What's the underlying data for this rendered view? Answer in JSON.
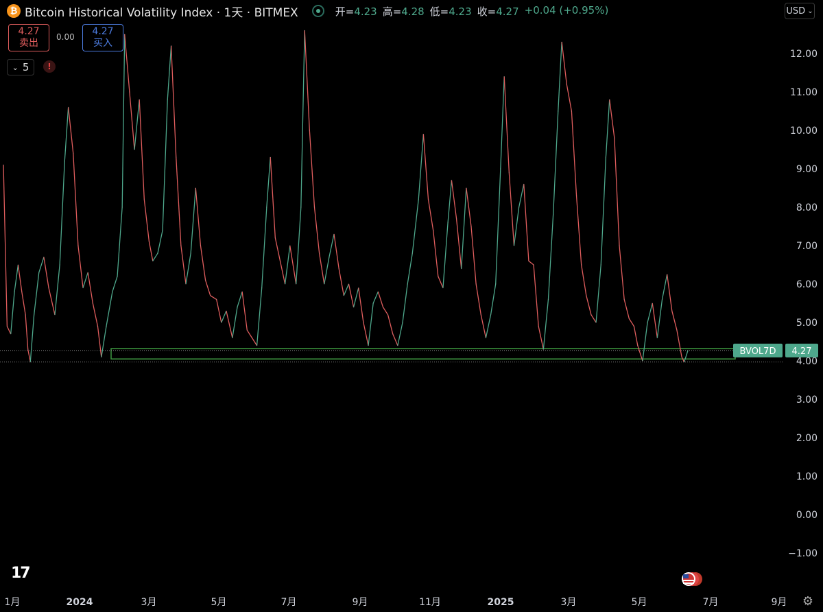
{
  "header": {
    "title": "Bitcoin Historical Volatility Index · 1天 · BITMEX",
    "icon": "bitcoin-icon",
    "ohlc": [
      {
        "key": "开=",
        "value": "4.23"
      },
      {
        "key": "高=",
        "value": "4.28"
      },
      {
        "key": "低=",
        "value": "4.23"
      },
      {
        "key": "收=",
        "value": "4.27"
      }
    ],
    "change": "+0.04 (+0.95%)"
  },
  "currency": {
    "label": "USD"
  },
  "trade": {
    "sell_price": "4.27",
    "sell_label": "卖出",
    "spread": "0.00",
    "buy_price": "4.27",
    "buy_label": "买入"
  },
  "indicators": {
    "count": "5"
  },
  "colors": {
    "up": "#4ea88c",
    "down": "#e05d5d",
    "zone": "#3f9a42",
    "background": "#000000"
  },
  "chart_data": {
    "type": "line",
    "symbol_label": "BVOL7D",
    "last_value": 4.27,
    "support_zone": [
      4.05,
      4.32
    ],
    "ylim": [
      -1.6,
      12.7
    ],
    "y_ticks": [
      12,
      11,
      10,
      9,
      8,
      7,
      6,
      5,
      4,
      3,
      2,
      1,
      0,
      -1
    ],
    "y_tick_labels": [
      "12.00",
      "11.00",
      "10.00",
      "9.00",
      "8.00",
      "7.00",
      "6.00",
      "5.00",
      "4.00",
      "3.00",
      "2.00",
      "1.00",
      "0.00",
      "−1.00"
    ],
    "x_tick_labels": [
      "1月",
      "2024",
      "3月",
      "5月",
      "7月",
      "9月",
      "11月",
      "2025",
      "3月",
      "5月",
      "7月",
      "9月"
    ],
    "x_tick_bold": [
      false,
      true,
      false,
      false,
      false,
      false,
      false,
      true,
      false,
      false,
      false,
      false
    ],
    "series": [
      {
        "points": [
          [
            "2023-12-03",
            9.1
          ],
          [
            "2023-12-06",
            4.9
          ],
          [
            "2023-12-09",
            4.7
          ],
          [
            "2023-12-12",
            5.8
          ],
          [
            "2023-12-15",
            6.5
          ],
          [
            "2023-12-18",
            5.8
          ],
          [
            "2023-12-21",
            5.2
          ],
          [
            "2023-12-23",
            4.3
          ],
          [
            "2023-12-25",
            3.97
          ],
          [
            "2023-12-28",
            5.2
          ],
          [
            "2024-01-01",
            6.3
          ],
          [
            "2024-01-05",
            6.7
          ],
          [
            "2024-01-09",
            5.9
          ],
          [
            "2024-01-14",
            5.2
          ],
          [
            "2024-01-18",
            6.5
          ],
          [
            "2024-01-22",
            9.2
          ],
          [
            "2024-01-25",
            10.6
          ],
          [
            "2024-01-29",
            9.4
          ],
          [
            "2024-02-02",
            7.0
          ],
          [
            "2024-02-06",
            5.9
          ],
          [
            "2024-02-10",
            6.3
          ],
          [
            "2024-02-14",
            5.5
          ],
          [
            "2024-02-18",
            4.9
          ],
          [
            "2024-02-21",
            4.1
          ],
          [
            "2024-02-25",
            4.9
          ],
          [
            "2024-03-01",
            5.8
          ],
          [
            "2024-03-05",
            6.2
          ],
          [
            "2024-03-09",
            8.0
          ],
          [
            "2024-03-11",
            12.5
          ],
          [
            "2024-03-15",
            11.0
          ],
          [
            "2024-03-19",
            9.5
          ],
          [
            "2024-03-23",
            10.8
          ],
          [
            "2024-03-27",
            8.2
          ],
          [
            "2024-03-31",
            7.1
          ],
          [
            "2024-04-03",
            6.6
          ],
          [
            "2024-04-07",
            6.8
          ],
          [
            "2024-04-11",
            7.4
          ],
          [
            "2024-04-15",
            10.8
          ],
          [
            "2024-04-18",
            12.2
          ],
          [
            "2024-04-22",
            9.3
          ],
          [
            "2024-04-26",
            7.0
          ],
          [
            "2024-04-30",
            6.0
          ],
          [
            "2024-05-04",
            6.8
          ],
          [
            "2024-05-08",
            8.5
          ],
          [
            "2024-05-12",
            7.0
          ],
          [
            "2024-05-16",
            6.1
          ],
          [
            "2024-05-20",
            5.7
          ],
          [
            "2024-05-25",
            5.6
          ],
          [
            "2024-05-29",
            5.0
          ],
          [
            "2024-06-02",
            5.3
          ],
          [
            "2024-06-07",
            4.6
          ],
          [
            "2024-06-11",
            5.4
          ],
          [
            "2024-06-15",
            5.8
          ],
          [
            "2024-06-19",
            4.8
          ],
          [
            "2024-06-23",
            4.6
          ],
          [
            "2024-06-27",
            4.4
          ],
          [
            "2024-07-01",
            5.9
          ],
          [
            "2024-07-05",
            8.0
          ],
          [
            "2024-07-08",
            9.3
          ],
          [
            "2024-07-12",
            7.2
          ],
          [
            "2024-07-16",
            6.6
          ],
          [
            "2024-07-20",
            6.0
          ],
          [
            "2024-07-24",
            7.0
          ],
          [
            "2024-07-29",
            6.0
          ],
          [
            "2024-08-02",
            8.0
          ],
          [
            "2024-08-05",
            12.6
          ],
          [
            "2024-08-09",
            10.0
          ],
          [
            "2024-08-13",
            8.0
          ],
          [
            "2024-08-17",
            6.8
          ],
          [
            "2024-08-21",
            6.0
          ],
          [
            "2024-08-25",
            6.7
          ],
          [
            "2024-08-29",
            7.3
          ],
          [
            "2024-09-02",
            6.4
          ],
          [
            "2024-09-06",
            5.7
          ],
          [
            "2024-09-10",
            6.0
          ],
          [
            "2024-09-14",
            5.4
          ],
          [
            "2024-09-18",
            5.9
          ],
          [
            "2024-09-22",
            5.0
          ],
          [
            "2024-09-26",
            4.4
          ],
          [
            "2024-09-30",
            5.5
          ],
          [
            "2024-10-04",
            5.8
          ],
          [
            "2024-10-08",
            5.4
          ],
          [
            "2024-10-12",
            5.2
          ],
          [
            "2024-10-16",
            4.7
          ],
          [
            "2024-10-20",
            4.4
          ],
          [
            "2024-10-24",
            5.0
          ],
          [
            "2024-10-28",
            6.0
          ],
          [
            "2024-11-01",
            6.8
          ],
          [
            "2024-11-06",
            8.2
          ],
          [
            "2024-11-10",
            9.9
          ],
          [
            "2024-11-14",
            8.2
          ],
          [
            "2024-11-18",
            7.4
          ],
          [
            "2024-11-22",
            6.2
          ],
          [
            "2024-11-26",
            5.9
          ],
          [
            "2024-11-30",
            7.6
          ],
          [
            "2024-12-03",
            8.7
          ],
          [
            "2024-12-07",
            7.7
          ],
          [
            "2024-12-11",
            6.4
          ],
          [
            "2024-12-15",
            8.5
          ],
          [
            "2024-12-19",
            7.5
          ],
          [
            "2024-12-23",
            6.0
          ],
          [
            "2024-12-27",
            5.2
          ],
          [
            "2024-12-31",
            4.6
          ],
          [
            "2025-01-04",
            5.2
          ],
          [
            "2025-01-08",
            6.0
          ],
          [
            "2025-01-12",
            9.0
          ],
          [
            "2025-01-15",
            11.4
          ],
          [
            "2025-01-19",
            8.9
          ],
          [
            "2025-01-23",
            7.0
          ],
          [
            "2025-01-27",
            8.0
          ],
          [
            "2025-01-31",
            8.6
          ],
          [
            "2025-02-04",
            6.6
          ],
          [
            "2025-02-08",
            6.5
          ],
          [
            "2025-02-12",
            4.9
          ],
          [
            "2025-02-16",
            4.3
          ],
          [
            "2025-02-20",
            5.6
          ],
          [
            "2025-02-24",
            7.8
          ],
          [
            "2025-02-28",
            10.5
          ],
          [
            "2025-03-03",
            12.3
          ],
          [
            "2025-03-07",
            11.2
          ],
          [
            "2025-03-11",
            10.5
          ],
          [
            "2025-03-15",
            8.3
          ],
          [
            "2025-03-19",
            6.5
          ],
          [
            "2025-03-23",
            5.7
          ],
          [
            "2025-03-27",
            5.2
          ],
          [
            "2025-03-31",
            5.0
          ],
          [
            "2025-04-04",
            6.5
          ],
          [
            "2025-04-08",
            9.3
          ],
          [
            "2025-04-11",
            10.8
          ],
          [
            "2025-04-15",
            9.8
          ],
          [
            "2025-04-19",
            7.0
          ],
          [
            "2025-04-23",
            5.6
          ],
          [
            "2025-04-27",
            5.1
          ],
          [
            "2025-05-01",
            4.9
          ],
          [
            "2025-05-04",
            4.4
          ],
          [
            "2025-05-08",
            4.0
          ],
          [
            "2025-05-12",
            5.0
          ],
          [
            "2025-05-16",
            5.5
          ],
          [
            "2025-05-20",
            4.6
          ],
          [
            "2025-05-24",
            5.6
          ],
          [
            "2025-05-28",
            6.25
          ],
          [
            "2025-06-01",
            5.3
          ],
          [
            "2025-06-05",
            4.8
          ],
          [
            "2025-06-09",
            4.1
          ],
          [
            "2025-06-11",
            3.97
          ],
          [
            "2025-06-14",
            4.27
          ]
        ]
      }
    ]
  }
}
